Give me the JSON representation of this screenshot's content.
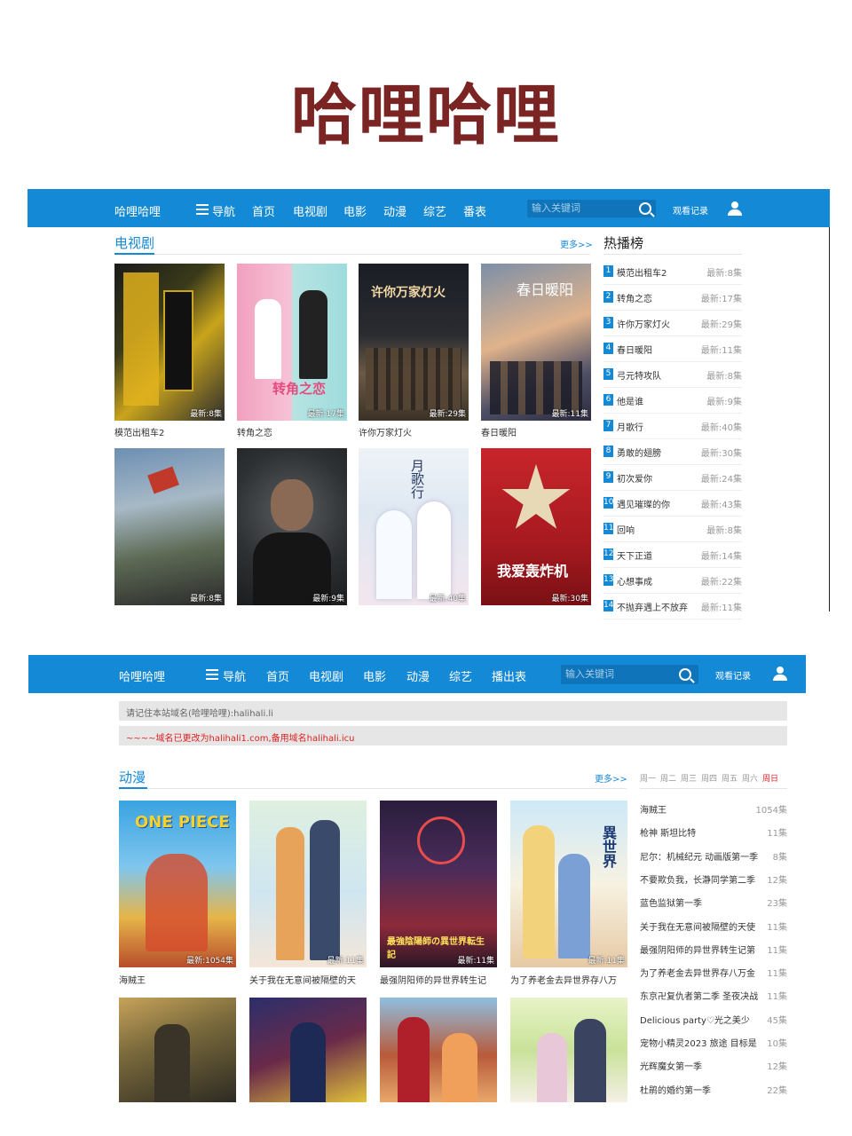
{
  "page_title": "哈哩哈哩",
  "nav1": {
    "brand": "哈哩哈哩",
    "items": [
      "导航",
      "首页",
      "电视剧",
      "电影",
      "动漫",
      "综艺",
      "番表"
    ],
    "search_placeholder": "输入关键词",
    "history": "观看记录"
  },
  "tv_section": {
    "title": "电视剧",
    "more": "更多>>",
    "row1": [
      {
        "title": "模范出租车2",
        "badge": "最新:8集"
      },
      {
        "title": "转角之恋",
        "badge": "最新:17集"
      },
      {
        "title": "许你万家灯火",
        "badge": "最新:29集"
      },
      {
        "title": "春日暖阳",
        "badge": "最新:11集"
      }
    ],
    "row2_badges": [
      "最新:8集",
      "最新:9集",
      "最新:40集",
      "最新:30集"
    ],
    "poster_texts": [
      "转角之恋",
      "许你万家灯火",
      "春日暖阳",
      "月歌行",
      "我爱轰炸机"
    ]
  },
  "hot": {
    "title": "热播榜",
    "items": [
      {
        "n": "1",
        "name": "模范出租车2",
        "ep": "最新:8集"
      },
      {
        "n": "2",
        "name": "转角之恋",
        "ep": "最新:17集"
      },
      {
        "n": "3",
        "name": "许你万家灯火",
        "ep": "最新:29集"
      },
      {
        "n": "4",
        "name": "春日暖阳",
        "ep": "最新:11集"
      },
      {
        "n": "5",
        "name": "弓元特攻队",
        "ep": "最新:8集"
      },
      {
        "n": "6",
        "name": "他是谁",
        "ep": "最新:9集"
      },
      {
        "n": "7",
        "name": "月歌行",
        "ep": "最新:40集"
      },
      {
        "n": "8",
        "name": "勇敢的翅膀",
        "ep": "最新:30集"
      },
      {
        "n": "9",
        "name": "初次爱你",
        "ep": "最新:24集"
      },
      {
        "n": "10",
        "name": "遇见璀璨的你",
        "ep": "最新:43集"
      },
      {
        "n": "11",
        "name": "回响",
        "ep": "最新:8集"
      },
      {
        "n": "12",
        "name": "天下正道",
        "ep": "最新:14集"
      },
      {
        "n": "13",
        "name": "心想事成",
        "ep": "最新:22集"
      },
      {
        "n": "14",
        "name": "不抛弃遇上不放弃",
        "ep": "最新:11集"
      }
    ]
  },
  "nav2": {
    "brand": "哈哩哈哩",
    "items": [
      "导航",
      "首页",
      "电视剧",
      "电影",
      "动漫",
      "综艺",
      "播出表"
    ],
    "search_placeholder": "输入关键词",
    "history": "观看记录"
  },
  "notices": {
    "domain": "请记住本站域名(哈哩哈哩):halihali.li",
    "change": "~~~~域名已更改为halihali1.com,备用域名halihali.icu"
  },
  "anime": {
    "title": "动漫",
    "more": "更多>>",
    "row1": [
      {
        "title": "海贼王",
        "badge": "最新:1054集"
      },
      {
        "title": "关于我在无意间被隔壁的天",
        "badge": "最新:11集"
      },
      {
        "title": "最强阴阳师的异世界转生记",
        "badge": "最新:11集"
      },
      {
        "title": "为了养老金去异世界存八万",
        "badge": "最新:11集"
      }
    ],
    "poster_texts": [
      "ONE PIECE",
      "最強陰陽師の異世界転生記",
      "異世界"
    ]
  },
  "week": {
    "days": [
      "周一",
      "周二",
      "周三",
      "周四",
      "周五",
      "周六",
      "周日"
    ],
    "items": [
      {
        "name": "海贼王",
        "count": "1054集"
      },
      {
        "name": "枪神 斯坦比特",
        "count": "11集"
      },
      {
        "name": "尼尔：机械纪元 动画版第一季",
        "count": "8集"
      },
      {
        "name": "不要欺负我，长瀞同学第二季",
        "count": "12集"
      },
      {
        "name": "蓝色监狱第一季",
        "count": "23集"
      },
      {
        "name": "关于我在无意间被隔壁的天使",
        "count": "11集"
      },
      {
        "name": "最强阴阳师的异世界转生记第",
        "count": "11集"
      },
      {
        "name": "为了养老金去异世界存八万金",
        "count": "11集"
      },
      {
        "name": "东京卍复仇者第二季 圣夜决战",
        "count": "11集"
      },
      {
        "name": "Delicious party♡光之美少",
        "count": "45集"
      },
      {
        "name": "宠物小精灵2023 旅途 目标是",
        "count": "10集"
      },
      {
        "name": "光辉魔女第一季",
        "count": "12集"
      },
      {
        "name": "杜鹃的婚约第一季",
        "count": "22集"
      }
    ]
  },
  "colors": {
    "brand_blue": "#1489d6",
    "title_red": "#7a2424",
    "active_red": "#e02020"
  }
}
